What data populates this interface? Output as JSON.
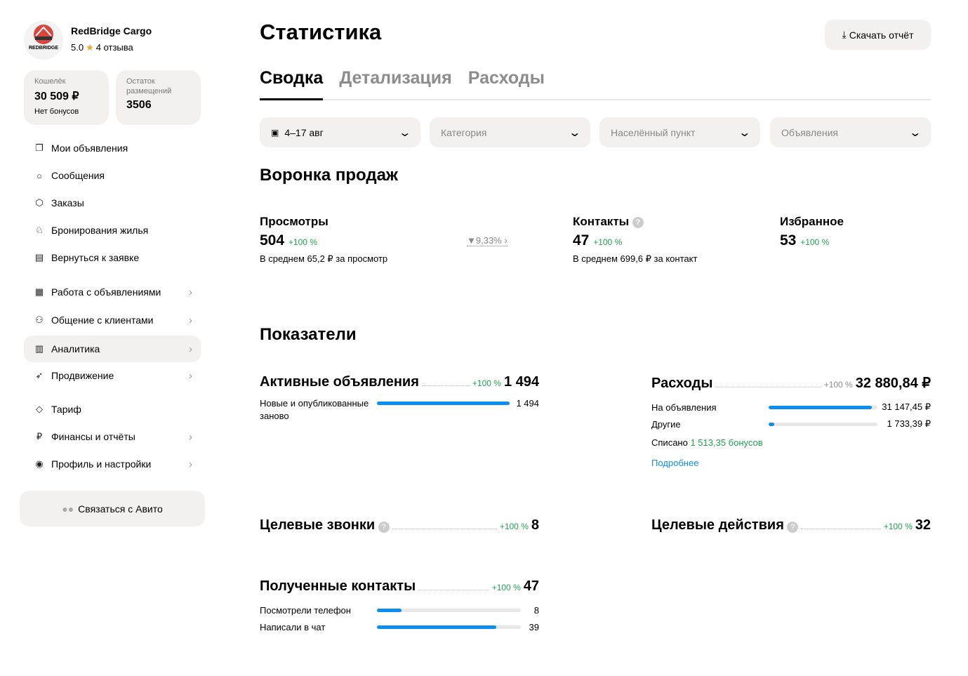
{
  "profile": {
    "name": "RedBridge Cargo",
    "logo_text": "REDBRIDGE CARGO",
    "rating": "5.0",
    "reviews": "4 отзыва"
  },
  "wallet": {
    "label": "Кошелёк",
    "value": "30 509 ₽",
    "sub": "Нет бонусов"
  },
  "placements": {
    "label": "Остаток размещений",
    "value": "3506"
  },
  "nav": [
    {
      "label": "Мои объявления",
      "icon": "listings-icon"
    },
    {
      "label": "Сообщения",
      "icon": "message-icon"
    },
    {
      "label": "Заказы",
      "icon": "box-icon"
    },
    {
      "label": "Бронирования жилья",
      "icon": "booking-icon"
    },
    {
      "label": "Вернуться к заявке",
      "icon": "calculator-icon"
    },
    {
      "label": "Работа с объявлениями",
      "icon": "layout-icon"
    },
    {
      "label": "Общение с клиентами",
      "icon": "users-icon"
    },
    {
      "label": "Аналитика",
      "icon": "chart-icon"
    },
    {
      "label": "Продвижение",
      "icon": "rocket-icon"
    },
    {
      "label": "Тариф",
      "icon": "diamond-icon"
    },
    {
      "label": "Финансы и отчёты",
      "icon": "ruble-icon"
    },
    {
      "label": "Профиль и настройки",
      "icon": "profile-icon"
    }
  ],
  "contact_button": "Связаться с Авито",
  "title": "Статистика",
  "download": "Скачать отчёт",
  "tabs": [
    "Сводка",
    "Детализация",
    "Расходы"
  ],
  "filters": {
    "date": "4–17 авг",
    "category": "Категория",
    "city": "Населённый пункт",
    "ads": "Объявления"
  },
  "funnel": {
    "title": "Воронка продаж",
    "views": {
      "label": "Просмотры",
      "value": "504",
      "change": "+100 %",
      "avg": "В среднем 65,2 ₽ за просмотр",
      "conversion": "9,33%"
    },
    "contacts": {
      "label": "Контакты",
      "value": "47",
      "change": "+100 %",
      "avg": "В среднем 699,6 ₽ за контакт"
    },
    "favorites": {
      "label": "Избранное",
      "value": "53",
      "change": "+100 %"
    }
  },
  "metrics": {
    "title": "Показатели",
    "active": {
      "label": "Активные объявления",
      "change": "+100 %",
      "value": "1 494",
      "rows": [
        {
          "label": "Новые и опубликованные заново",
          "value": "1 494",
          "fill": 1.0
        }
      ]
    },
    "expenses": {
      "label": "Расходы",
      "change": "+100 %",
      "value": "32 880,84 ₽",
      "rows": [
        {
          "label": "На объявления",
          "value": "31 147,45 ₽",
          "fill": 0.947
        },
        {
          "label": "Другие",
          "value": "1 733,39 ₽",
          "fill": 0.053
        }
      ],
      "written_off_label": "Списано",
      "written_off_value": "1 513,35 бонусов",
      "more": "Подробнее"
    },
    "calls": {
      "label": "Целевые звонки",
      "change": "+100 %",
      "value": "8"
    },
    "actions": {
      "label": "Целевые действия",
      "change": "+100 %",
      "value": "32"
    },
    "contacts": {
      "label": "Полученные контакты",
      "change": "+100 %",
      "value": "47",
      "rows": [
        {
          "label": "Посмотрели телефон",
          "value": "8",
          "fill": 0.17
        },
        {
          "label": "Написали в чат",
          "value": "39",
          "fill": 0.83
        }
      ]
    }
  }
}
